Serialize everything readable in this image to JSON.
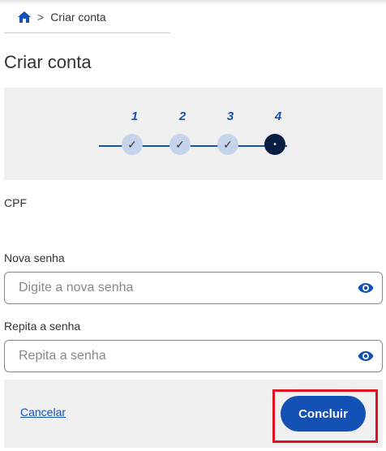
{
  "breadcrumb": {
    "separator": ">",
    "current": "Criar conta"
  },
  "page_title": "Criar conta",
  "stepper": {
    "steps": [
      {
        "number": "1",
        "state": "done",
        "mark": "✓"
      },
      {
        "number": "2",
        "state": "done",
        "mark": "✓"
      },
      {
        "number": "3",
        "state": "done",
        "mark": "✓"
      },
      {
        "number": "4",
        "state": "active",
        "mark": "•"
      }
    ],
    "colors": {
      "line": "#1351b4",
      "done": "#c5d4eb",
      "active": "#071d41"
    }
  },
  "form": {
    "cpf_label": "CPF",
    "new_password": {
      "label": "Nova senha",
      "placeholder": "Digite a nova senha",
      "value": ""
    },
    "repeat_password": {
      "label": "Repita a senha",
      "placeholder": "Repita a senha",
      "value": ""
    }
  },
  "footer": {
    "cancel_label": "Cancelar",
    "submit_label": "Concluir"
  },
  "icons": {
    "home": "home-icon",
    "eye": "eye-icon"
  },
  "colors": {
    "accent": "#1351b4",
    "highlight": "#e0101e"
  }
}
